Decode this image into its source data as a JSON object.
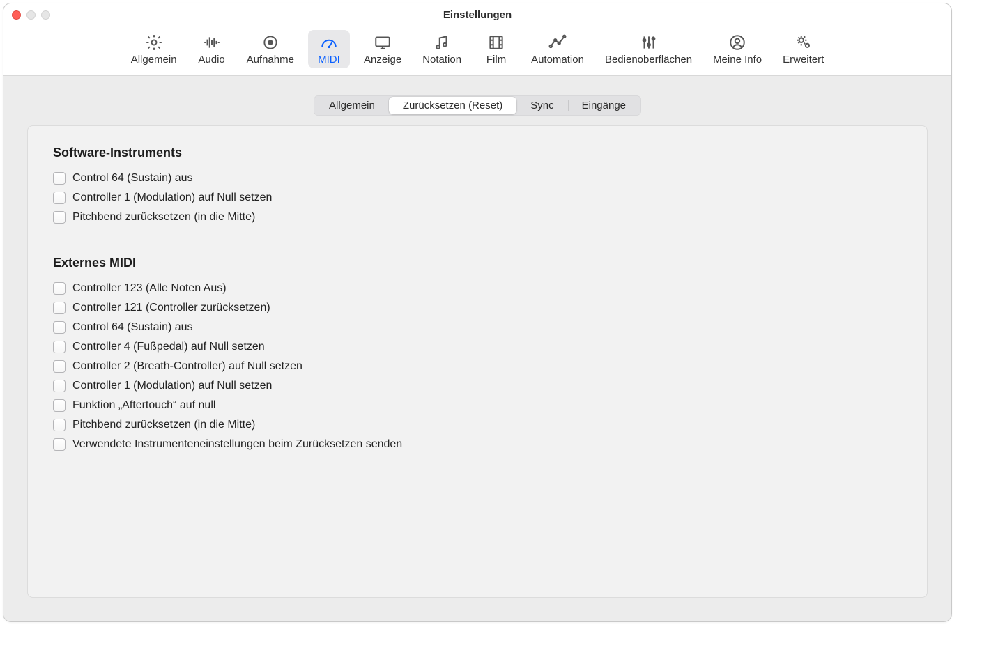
{
  "window": {
    "title": "Einstellungen"
  },
  "toolbar": {
    "items": [
      {
        "id": "general",
        "label": "Allgemein"
      },
      {
        "id": "audio",
        "label": "Audio"
      },
      {
        "id": "record",
        "label": "Aufnahme"
      },
      {
        "id": "midi",
        "label": "MIDI",
        "selected": true
      },
      {
        "id": "display",
        "label": "Anzeige"
      },
      {
        "id": "score",
        "label": "Notation"
      },
      {
        "id": "movie",
        "label": "Film"
      },
      {
        "id": "automation",
        "label": "Automation"
      },
      {
        "id": "surfaces",
        "label": "Bedienoberflächen"
      },
      {
        "id": "myinfo",
        "label": "Meine Info"
      },
      {
        "id": "advanced",
        "label": "Erweitert"
      }
    ]
  },
  "tabs": {
    "items": [
      {
        "id": "allgemein",
        "label": "Allgemein"
      },
      {
        "id": "reset",
        "label": "Zurücksetzen (Reset)",
        "active": true
      },
      {
        "id": "sync",
        "label": "Sync"
      },
      {
        "id": "inputs",
        "label": "Eingänge"
      }
    ]
  },
  "sections": {
    "software": {
      "title": "Software-Instruments",
      "items": [
        "Control 64 (Sustain) aus",
        "Controller 1 (Modulation) auf Null setzen",
        "Pitchbend zurücksetzen (in die Mitte)"
      ]
    },
    "external": {
      "title": "Externes MIDI",
      "items": [
        "Controller 123 (Alle Noten Aus)",
        "Controller 121 (Controller zurücksetzen)",
        "Control 64 (Sustain) aus",
        "Controller 4 (Fußpedal) auf Null setzen",
        "Controller 2 (Breath-Controller) auf Null setzen",
        "Controller 1 (Modulation) auf Null setzen",
        "Funktion „Aftertouch“ auf null",
        "Pitchbend zurücksetzen (in die Mitte)",
        "Verwendete Instrumenteneinstellungen beim Zurücksetzen senden"
      ]
    }
  }
}
